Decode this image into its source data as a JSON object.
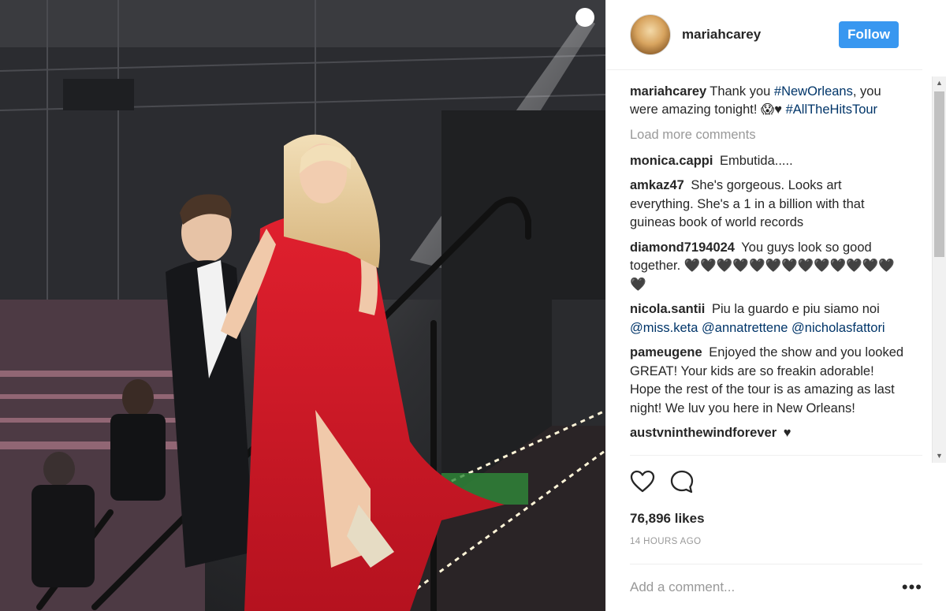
{
  "post": {
    "username": "mariahcarey",
    "follow_label": "Follow",
    "caption": {
      "user": "mariahcarey",
      "text_1": "Thank you ",
      "tag_1": "#NewOrleans",
      "text_2": ", you were amazing tonight! 😱♥ ",
      "tag_2": "#AllTheHitsTour"
    },
    "load_more": "Load more comments",
    "comments": [
      {
        "user": "monica.cappi",
        "text": "Embutida.....",
        "mentions": []
      },
      {
        "user": "amkaz47",
        "text": "She's gorgeous. Looks art everything. She's a 1 in a billion with that guineas book of world records",
        "mentions": []
      },
      {
        "user": "diamond7194024",
        "text": "You guys look so good together. 🖤🖤🖤🖤🖤🖤🖤🖤🖤🖤🖤🖤🖤🖤",
        "mentions": []
      },
      {
        "user": "nicola.santii",
        "text": "Piu la guardo e piu siamo noi",
        "mentions": [
          "@miss.keta",
          "@annatrettene",
          "@nicholasfattori"
        ]
      },
      {
        "user": "pameugene",
        "text": "Enjoyed the show and you looked GREAT! Your kids are so freakin adorable! Hope the rest of the tour is as amazing as last night! We luv you here in New Orleans!",
        "mentions": []
      },
      {
        "user": "austvninthewindforever",
        "text": "♥",
        "mentions": []
      }
    ],
    "likes": "76,896 likes",
    "timestamp": "14 HOURS AGO",
    "add_comment_placeholder": "Add a comment...",
    "more_label": "•••",
    "scroll_up": "▲",
    "scroll_down": "▼",
    "icons": {
      "like": "heart-icon",
      "comment": "comment-bubble-icon"
    },
    "colors": {
      "follow": "#3897f0",
      "link": "#003569",
      "muted": "#999999"
    }
  }
}
